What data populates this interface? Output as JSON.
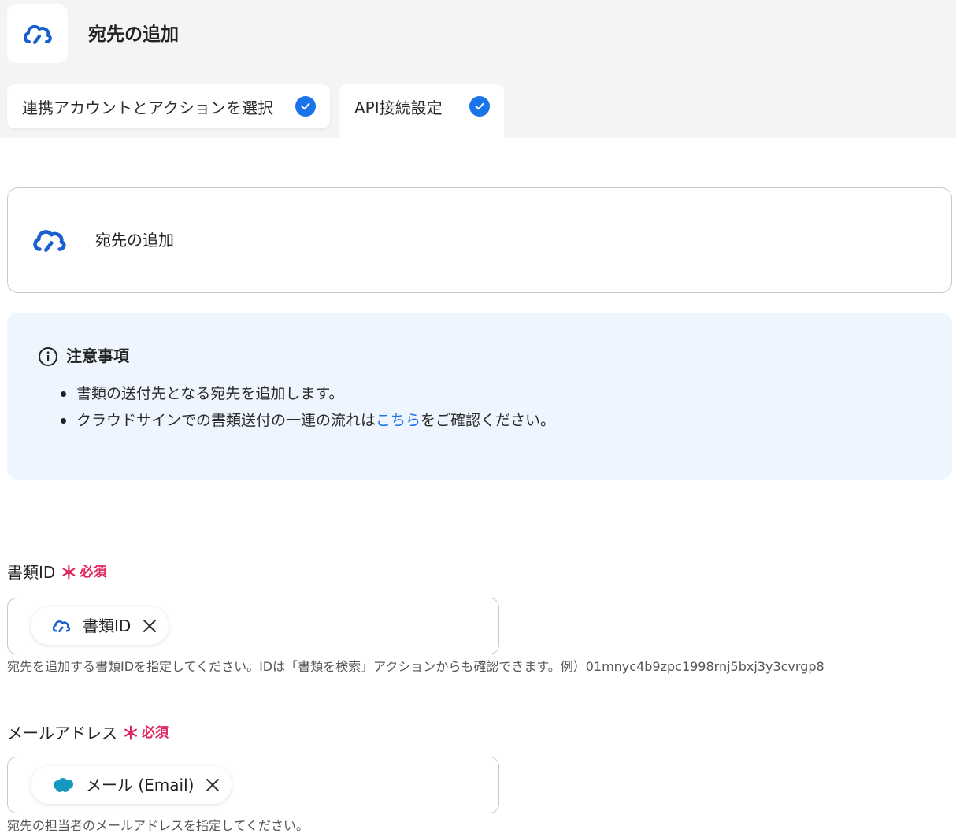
{
  "header": {
    "title": "宛先の追加"
  },
  "steps": [
    {
      "label": "連携アカウントとアクションを選択",
      "completed": true
    },
    {
      "label": "API接続設定",
      "completed": true
    }
  ],
  "action_card": {
    "label": "宛先の追加",
    "icon": "cloudsign-icon"
  },
  "notice": {
    "title": "注意事項",
    "items": [
      {
        "text": "書類の送付先となる宛先を追加します。"
      },
      {
        "before": "クラウドサインでの書類送付の一連の流れは",
        "link": "こちら",
        "after": "をご確認ください。"
      }
    ]
  },
  "fields": {
    "document_id": {
      "label": "書類ID",
      "required_mark": "＊",
      "required_text": "必須",
      "chip": {
        "label": "書類ID",
        "icon": "cloudsign-icon"
      },
      "help": "宛先を追加する書類IDを指定してください。IDは「書類を検索」アクションからも確認できます。例）01mnyc4b9zpc1998rnj5bxj3y3cvrgp8"
    },
    "email": {
      "label": "メールアドレス",
      "required_mark": "＊",
      "required_text": "必須",
      "chip": {
        "label": "メール (Email)",
        "icon": "salesforce-cloud-icon"
      },
      "help": "宛先の担当者のメールアドレスを指定してください。"
    }
  },
  "colors": {
    "accent": "#1a73e8",
    "required": "#e0245e",
    "notice_bg": "#eef5fe",
    "salesforce": "#1798c1"
  }
}
